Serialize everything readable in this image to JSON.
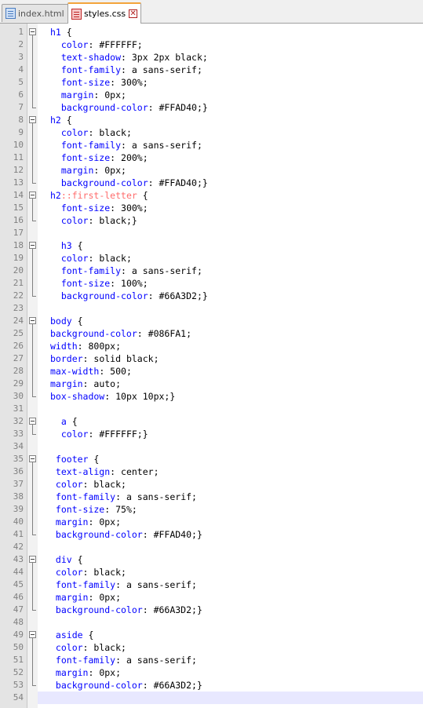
{
  "tabs": [
    {
      "label": "index.html",
      "active": false
    },
    {
      "label": "styles.css",
      "active": true
    }
  ],
  "lines": [
    {
      "n": "1",
      "tokens": [
        [
          "sel",
          "h1"
        ],
        [
          "punc",
          " {"
        ]
      ]
    },
    {
      "n": "2",
      "tokens": [
        [
          "prop",
          "  color"
        ],
        [
          "punc",
          ": "
        ],
        [
          "val",
          "#FFFFFF;"
        ]
      ]
    },
    {
      "n": "3",
      "tokens": [
        [
          "prop",
          "  text-shadow"
        ],
        [
          "punc",
          ": "
        ],
        [
          "val",
          "3px 2px black;"
        ]
      ]
    },
    {
      "n": "4",
      "tokens": [
        [
          "prop",
          "  font-family"
        ],
        [
          "punc",
          ": "
        ],
        [
          "val",
          "a sans-serif;"
        ]
      ]
    },
    {
      "n": "5",
      "tokens": [
        [
          "prop",
          "  font-size"
        ],
        [
          "punc",
          ": "
        ],
        [
          "val",
          "300%;"
        ]
      ]
    },
    {
      "n": "6",
      "tokens": [
        [
          "prop",
          "  margin"
        ],
        [
          "punc",
          ": "
        ],
        [
          "val",
          "0px;"
        ]
      ]
    },
    {
      "n": "7",
      "tokens": [
        [
          "prop",
          "  background-color"
        ],
        [
          "punc",
          ": "
        ],
        [
          "val",
          "#FFAD40;}"
        ]
      ]
    },
    {
      "n": "8",
      "tokens": [
        [
          "sel",
          "h2"
        ],
        [
          "punc",
          " {"
        ]
      ]
    },
    {
      "n": "9",
      "tokens": [
        [
          "prop",
          "  color"
        ],
        [
          "punc",
          ": "
        ],
        [
          "val",
          "black;"
        ]
      ]
    },
    {
      "n": "10",
      "tokens": [
        [
          "prop",
          "  font-family"
        ],
        [
          "punc",
          ": "
        ],
        [
          "val",
          "a sans-serif;"
        ]
      ]
    },
    {
      "n": "11",
      "tokens": [
        [
          "prop",
          "  font-size"
        ],
        [
          "punc",
          ": "
        ],
        [
          "val",
          "200%;"
        ]
      ]
    },
    {
      "n": "12",
      "tokens": [
        [
          "prop",
          "  margin"
        ],
        [
          "punc",
          ": "
        ],
        [
          "val",
          "0px;"
        ]
      ]
    },
    {
      "n": "13",
      "tokens": [
        [
          "prop",
          "  background-color"
        ],
        [
          "punc",
          ": "
        ],
        [
          "val",
          "#FFAD40;}"
        ]
      ]
    },
    {
      "n": "14",
      "tokens": [
        [
          "sel",
          "h2"
        ],
        [
          "pseudo",
          "::first-letter"
        ],
        [
          "punc",
          " {"
        ]
      ]
    },
    {
      "n": "15",
      "tokens": [
        [
          "prop",
          "  font-size"
        ],
        [
          "punc",
          ": "
        ],
        [
          "val",
          "300%;"
        ]
      ]
    },
    {
      "n": "16",
      "tokens": [
        [
          "prop",
          "  color"
        ],
        [
          "punc",
          ": "
        ],
        [
          "val",
          "black;}"
        ]
      ]
    },
    {
      "n": "17",
      "tokens": []
    },
    {
      "n": "18",
      "tokens": [
        [
          "sel",
          "  h3"
        ],
        [
          "punc",
          " {"
        ]
      ]
    },
    {
      "n": "19",
      "tokens": [
        [
          "prop",
          "  color"
        ],
        [
          "punc",
          ": "
        ],
        [
          "val",
          "black;"
        ]
      ]
    },
    {
      "n": "20",
      "tokens": [
        [
          "prop",
          "  font-family"
        ],
        [
          "punc",
          ": "
        ],
        [
          "val",
          "a sans-serif;"
        ]
      ]
    },
    {
      "n": "21",
      "tokens": [
        [
          "prop",
          "  font-size"
        ],
        [
          "punc",
          ": "
        ],
        [
          "val",
          "100%;"
        ]
      ]
    },
    {
      "n": "22",
      "tokens": [
        [
          "prop",
          "  background-color"
        ],
        [
          "punc",
          ": "
        ],
        [
          "val",
          "#66A3D2;}"
        ]
      ]
    },
    {
      "n": "23",
      "tokens": []
    },
    {
      "n": "24",
      "tokens": [
        [
          "sel",
          "body"
        ],
        [
          "punc",
          " {"
        ]
      ]
    },
    {
      "n": "25",
      "tokens": [
        [
          "prop",
          "background-color"
        ],
        [
          "punc",
          ": "
        ],
        [
          "val",
          "#086FA1;"
        ]
      ]
    },
    {
      "n": "26",
      "tokens": [
        [
          "prop",
          "width"
        ],
        [
          "punc",
          ": "
        ],
        [
          "val",
          "800px;"
        ]
      ]
    },
    {
      "n": "27",
      "tokens": [
        [
          "prop",
          "border"
        ],
        [
          "punc",
          ": "
        ],
        [
          "val",
          "solid black;"
        ]
      ]
    },
    {
      "n": "28",
      "tokens": [
        [
          "prop",
          "max-width"
        ],
        [
          "punc",
          ": "
        ],
        [
          "val",
          "500;"
        ]
      ]
    },
    {
      "n": "29",
      "tokens": [
        [
          "prop",
          "margin"
        ],
        [
          "punc",
          ": "
        ],
        [
          "val",
          "auto;"
        ]
      ]
    },
    {
      "n": "30",
      "tokens": [
        [
          "prop",
          "box-shadow"
        ],
        [
          "punc",
          ": "
        ],
        [
          "val",
          "10px 10px;}"
        ]
      ]
    },
    {
      "n": "31",
      "tokens": []
    },
    {
      "n": "32",
      "tokens": [
        [
          "sel",
          "  a"
        ],
        [
          "punc",
          " {"
        ]
      ]
    },
    {
      "n": "33",
      "tokens": [
        [
          "prop",
          "  color"
        ],
        [
          "punc",
          ": "
        ],
        [
          "val",
          "#FFFFFF;}"
        ]
      ]
    },
    {
      "n": "34",
      "tokens": []
    },
    {
      "n": "35",
      "tokens": [
        [
          "sel",
          " footer"
        ],
        [
          "punc",
          " {"
        ]
      ]
    },
    {
      "n": "36",
      "tokens": [
        [
          "prop",
          " text-align"
        ],
        [
          "punc",
          ": "
        ],
        [
          "val",
          "center;"
        ]
      ]
    },
    {
      "n": "37",
      "tokens": [
        [
          "prop",
          " color"
        ],
        [
          "punc",
          ": "
        ],
        [
          "val",
          "black;"
        ]
      ]
    },
    {
      "n": "38",
      "tokens": [
        [
          "prop",
          " font-family"
        ],
        [
          "punc",
          ": "
        ],
        [
          "val",
          "a sans-serif;"
        ]
      ]
    },
    {
      "n": "39",
      "tokens": [
        [
          "prop",
          " font-size"
        ],
        [
          "punc",
          ": "
        ],
        [
          "val",
          "75%;"
        ]
      ]
    },
    {
      "n": "40",
      "tokens": [
        [
          "prop",
          " margin"
        ],
        [
          "punc",
          ": "
        ],
        [
          "val",
          "0px;"
        ]
      ]
    },
    {
      "n": "41",
      "tokens": [
        [
          "prop",
          " background-color"
        ],
        [
          "punc",
          ": "
        ],
        [
          "val",
          "#FFAD40;}"
        ]
      ]
    },
    {
      "n": "42",
      "tokens": []
    },
    {
      "n": "43",
      "tokens": [
        [
          "sel",
          " div"
        ],
        [
          "punc",
          " {"
        ]
      ]
    },
    {
      "n": "44",
      "tokens": [
        [
          "prop",
          " color"
        ],
        [
          "punc",
          ": "
        ],
        [
          "val",
          "black;"
        ]
      ]
    },
    {
      "n": "45",
      "tokens": [
        [
          "prop",
          " font-family"
        ],
        [
          "punc",
          ": "
        ],
        [
          "val",
          "a sans-serif;"
        ]
      ]
    },
    {
      "n": "46",
      "tokens": [
        [
          "prop",
          " margin"
        ],
        [
          "punc",
          ": "
        ],
        [
          "val",
          "0px;"
        ]
      ]
    },
    {
      "n": "47",
      "tokens": [
        [
          "prop",
          " background-color"
        ],
        [
          "punc",
          ": "
        ],
        [
          "val",
          "#66A3D2;}"
        ]
      ]
    },
    {
      "n": "48",
      "tokens": []
    },
    {
      "n": "49",
      "tokens": [
        [
          "sel",
          " aside"
        ],
        [
          "punc",
          " {"
        ]
      ]
    },
    {
      "n": "50",
      "tokens": [
        [
          "prop",
          " color"
        ],
        [
          "punc",
          ": "
        ],
        [
          "val",
          "black;"
        ]
      ]
    },
    {
      "n": "51",
      "tokens": [
        [
          "prop",
          " font-family"
        ],
        [
          "punc",
          ": "
        ],
        [
          "val",
          "a sans-serif;"
        ]
      ]
    },
    {
      "n": "52",
      "tokens": [
        [
          "prop",
          " margin"
        ],
        [
          "punc",
          ": "
        ],
        [
          "val",
          "0px;"
        ]
      ]
    },
    {
      "n": "53",
      "tokens": [
        [
          "prop",
          " background-color"
        ],
        [
          "punc",
          ": "
        ],
        [
          "val",
          "#66A3D2;}"
        ]
      ]
    },
    {
      "n": "54",
      "tokens": []
    }
  ],
  "current_line": "54",
  "colors": {
    "selector": "#0000ff",
    "property": "#0000ff",
    "pseudo": "#ff6b6b",
    "value": "#000000",
    "active_tab_accent": "#f3a43b",
    "current_line_bg": "#e8e8ff"
  }
}
